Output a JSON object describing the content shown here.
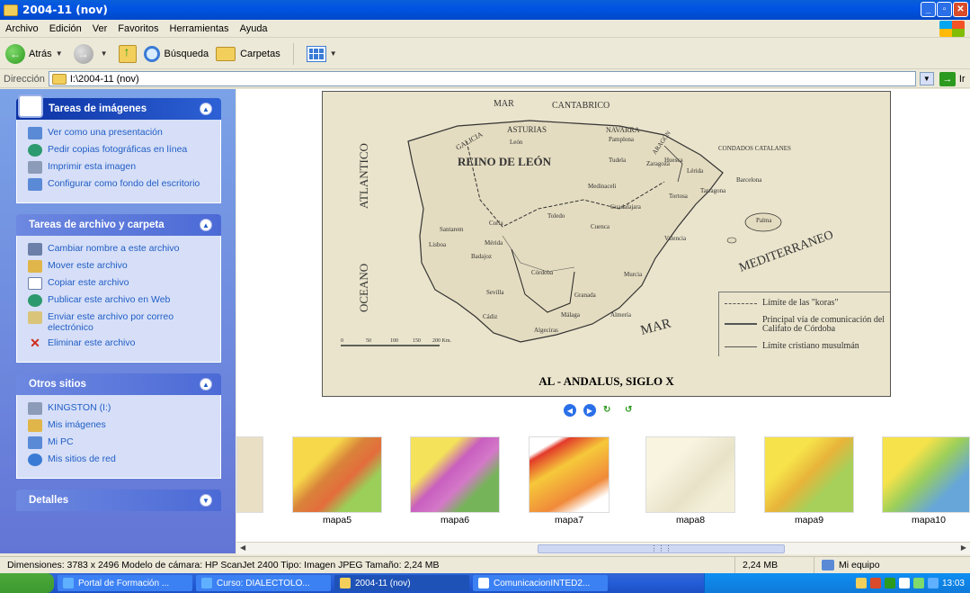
{
  "window": {
    "title": "2004-11 (nov)"
  },
  "menu": [
    "Archivo",
    "Edición",
    "Ver",
    "Favoritos",
    "Herramientas",
    "Ayuda"
  ],
  "toolbar": {
    "back": "Atrás",
    "search": "Búsqueda",
    "folders": "Carpetas"
  },
  "address": {
    "label": "Dirección",
    "value": "I:\\2004-11 (nov)",
    "go": "Ir"
  },
  "tasks": {
    "images": {
      "title": "Tareas de imágenes",
      "items": [
        "Ver como una presentación",
        "Pedir copias fotográficas en línea",
        "Imprimir esta imagen",
        "Configurar como fondo del escritorio"
      ]
    },
    "files": {
      "title": "Tareas de archivo y carpeta",
      "items": [
        "Cambiar nombre a este archivo",
        "Mover este archivo",
        "Copiar este archivo",
        "Publicar este archivo en Web",
        "Enviar este archivo por correo electrónico",
        "Eliminar este archivo"
      ]
    },
    "places": {
      "title": "Otros sitios",
      "items": [
        "KINGSTON (I:)",
        "Mis imágenes",
        "Mi PC",
        "Mis sitios de red"
      ]
    },
    "details": {
      "title": "Detalles"
    }
  },
  "map": {
    "title": "AL - ANDALUS, SIGLO X",
    "seas": [
      "MAR",
      "CANTABRICO",
      "ATLANTICO",
      "OCEANO",
      "MEDITERRANEO",
      "MAR"
    ],
    "regions": [
      "ASTURIAS",
      "NAVARRA",
      "GALICIA",
      "REINO DE LEÓN",
      "CONDADOS CATALANES",
      "ARAGÓN"
    ],
    "cities": [
      "León",
      "Pamplona",
      "Toledo",
      "Córdoba",
      "Sevilla",
      "Granada",
      "Málaga",
      "Almería",
      "Algeciras",
      "Cádiz",
      "Valencia",
      "Murcia",
      "Zaragoza",
      "Lérida",
      "Barcelona",
      "Tarragona",
      "Tortosa",
      "Mérida",
      "Badajoz",
      "Lisboa",
      "Santarem",
      "Coria",
      "Medinaceli",
      "Guadalajara",
      "Cuenca",
      "Huesca",
      "Tudela",
      "Palma"
    ],
    "legend": [
      "Límite de las \"koras\"",
      "Principal vía de comunicación del Califato de Córdoba",
      "Límite cristiano musulmán"
    ],
    "scale": [
      "0",
      "50",
      "100",
      "150",
      "200 Km."
    ]
  },
  "thumbnails": [
    "mapa5",
    "mapa6",
    "mapa7",
    "mapa8",
    "mapa9",
    "mapa10"
  ],
  "status": {
    "info": "Dimensiones: 3783 x 2496 Modelo de cámara: HP ScanJet 2400 Tipo: Imagen JPEG Tamaño: 2,24 MB",
    "size": "2,24 MB",
    "location": "Mi equipo"
  },
  "taskbar": {
    "items": [
      "Portal de Formación ...",
      "Curso: DIALECTOLO...",
      "2004-11 (nov)",
      "ComunicacionINTED2..."
    ],
    "clock": "13:03"
  }
}
